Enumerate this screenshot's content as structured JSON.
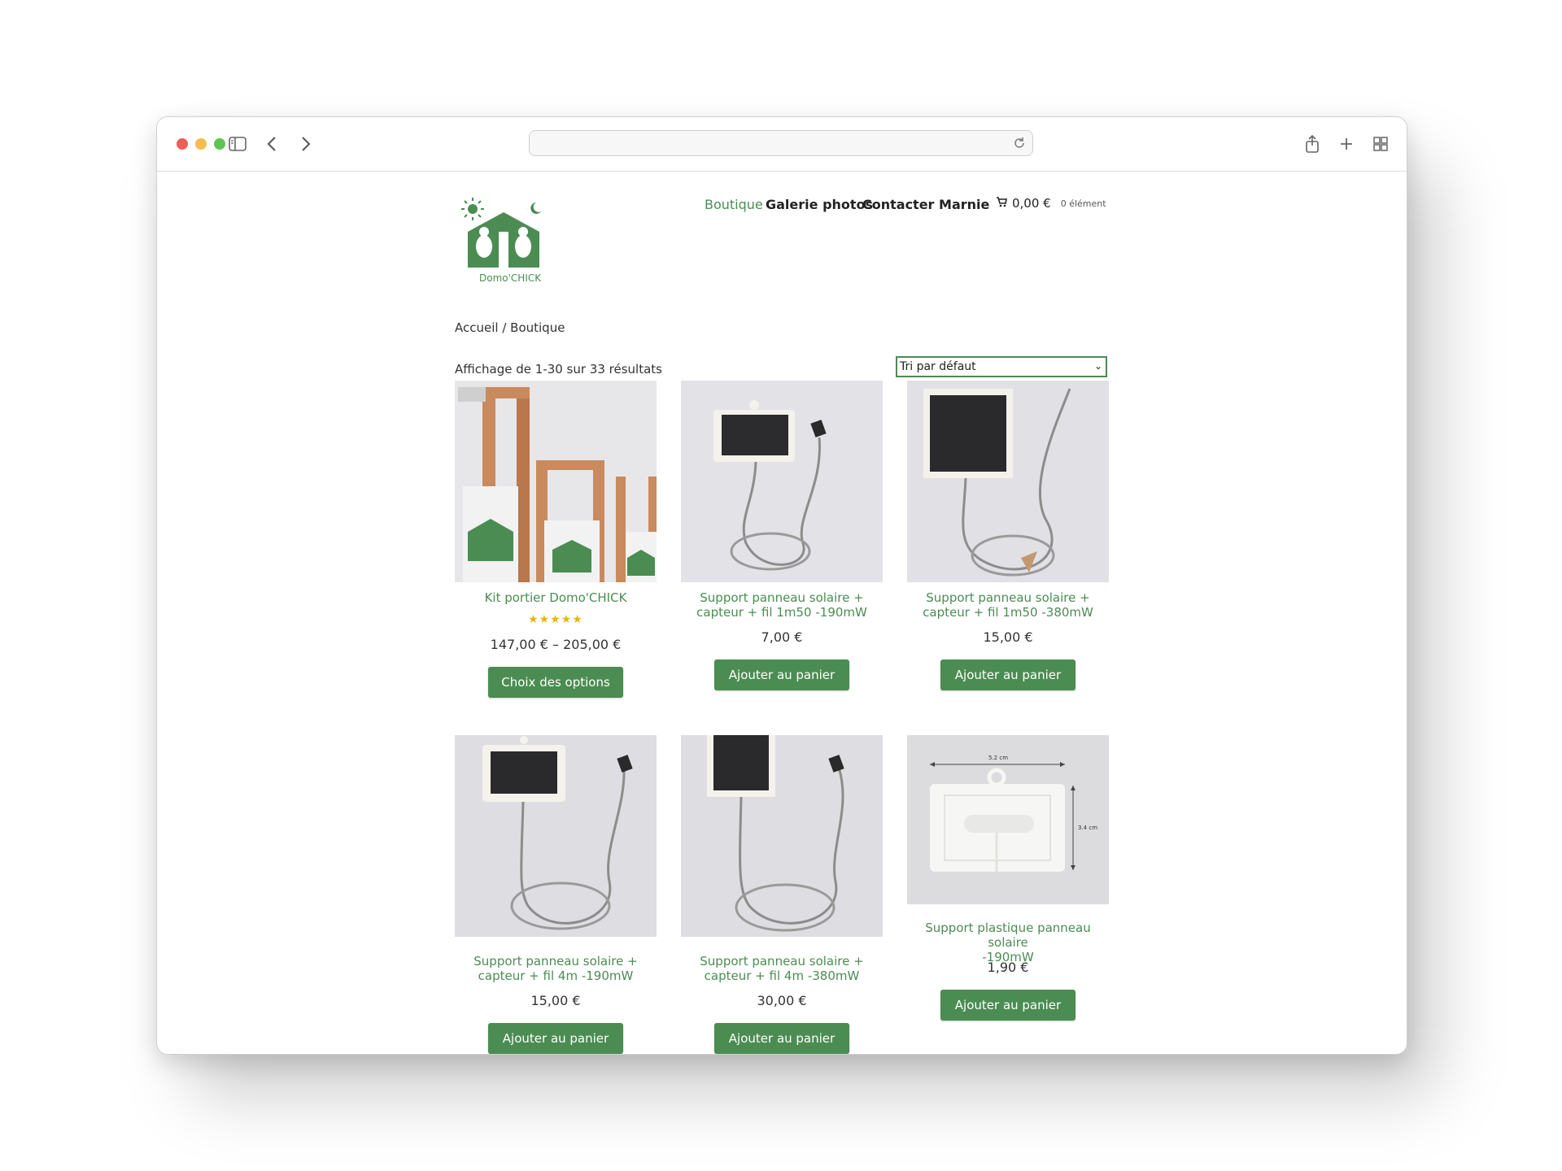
{
  "site": {
    "logo_text": "Domo'CHICK"
  },
  "nav": {
    "items": [
      "Boutique",
      "Galerie photos",
      "Contacter Marnie"
    ],
    "cart_amount": "0,00 €",
    "cart_count": "0 élément"
  },
  "breadcrumb": "Accueil / Boutique",
  "shop": {
    "result_count": "Affichage de 1-30 sur 33 résultats",
    "sort_selected": "Tri par défaut"
  },
  "products": [
    {
      "title_lines": [
        "Kit portier Domo'CHICK"
      ],
      "rating_stars": "★★★★★",
      "rating": 5,
      "price": "147,00 € – 205,00 €",
      "button": "Choix des options"
    },
    {
      "title_lines": [
        "Support panneau solaire +",
        "capteur + fil 1m50 -190mW"
      ],
      "price": "7,00 €",
      "button": "Ajouter au panier"
    },
    {
      "title_lines": [
        "Support panneau solaire +",
        "capteur + fil 1m50 -380mW"
      ],
      "price": "15,00 €",
      "button": "Ajouter au panier"
    },
    {
      "title_lines": [
        "Support panneau solaire +",
        "capteur + fil 4m -190mW"
      ],
      "price": "15,00 €",
      "button": "Ajouter au panier"
    },
    {
      "title_lines": [
        "Support panneau solaire +",
        "capteur + fil 4m -380mW"
      ],
      "price": "30,00 €",
      "button": "Ajouter au panier"
    },
    {
      "title_lines": [
        "Support plastique panneau solaire",
        "-190mW"
      ],
      "price": "1,90 €",
      "button": "Ajouter au panier",
      "dimension_labels": [
        "5.2 cm",
        "3.4 cm"
      ]
    }
  ],
  "colors": {
    "brand_green": "#4b8c52",
    "star_yellow": "#e5b611"
  },
  "icons": [
    "sidebar-icon",
    "back-arrow-icon",
    "forward-arrow-icon",
    "reload-icon",
    "share-icon",
    "new-tab-icon",
    "tabs-grid-icon",
    "cart-icon"
  ]
}
